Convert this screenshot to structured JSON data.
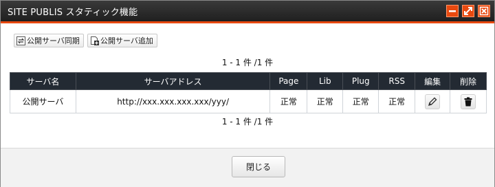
{
  "window": {
    "title": "SITE PUBLIS スタティック機能"
  },
  "toolbar": {
    "sync_label": "公開サーバ同期",
    "add_label": "公開サーバ追加"
  },
  "pager": {
    "top": "1 - 1 件 /1 件",
    "bottom": "1 - 1 件 /1 件"
  },
  "table": {
    "headers": [
      "サーバ名",
      "サーバアドレス",
      "Page",
      "Lib",
      "Plug",
      "RSS",
      "編集",
      "削除"
    ],
    "rows": [
      {
        "name": "公開サーバ",
        "address": "http://xxx.xxx.xxx.xxx/yyy/",
        "page": "正常",
        "lib": "正常",
        "plug": "正常",
        "rss": "正常"
      }
    ]
  },
  "footer": {
    "close_label": "閉じる"
  },
  "colors": {
    "accent": "#e8490f",
    "header_bg": "#232a33"
  },
  "icons": [
    "minimize-icon",
    "maximize-icon",
    "close-icon",
    "sync-icon",
    "add-page-icon",
    "pencil-icon",
    "trash-icon"
  ]
}
